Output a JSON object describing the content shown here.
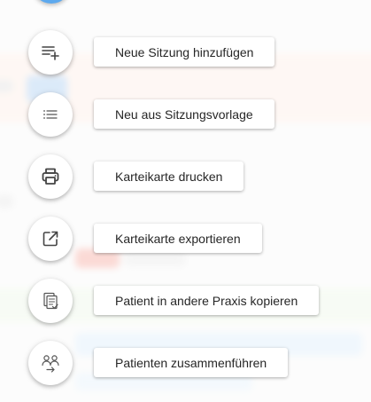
{
  "menu": {
    "actions": [
      {
        "label": "Neue Sitzung hinzufügen",
        "icon": "playlist-add-icon"
      },
      {
        "label": "Neu aus Sitzungsvorlage",
        "icon": "list-icon"
      },
      {
        "label": "Karteikarte drucken",
        "icon": "printer-icon"
      },
      {
        "label": "Karteikarte exportieren",
        "icon": "export-icon"
      },
      {
        "label": "Patient in andere Praxis kopieren",
        "icon": "copy-documents-icon"
      },
      {
        "label": "Patienten zusammenführen",
        "icon": "merge-people-icon"
      }
    ]
  },
  "colors": {
    "fab_primary": "#5da9ee",
    "icon": "#444444",
    "label_text": "#262626"
  }
}
